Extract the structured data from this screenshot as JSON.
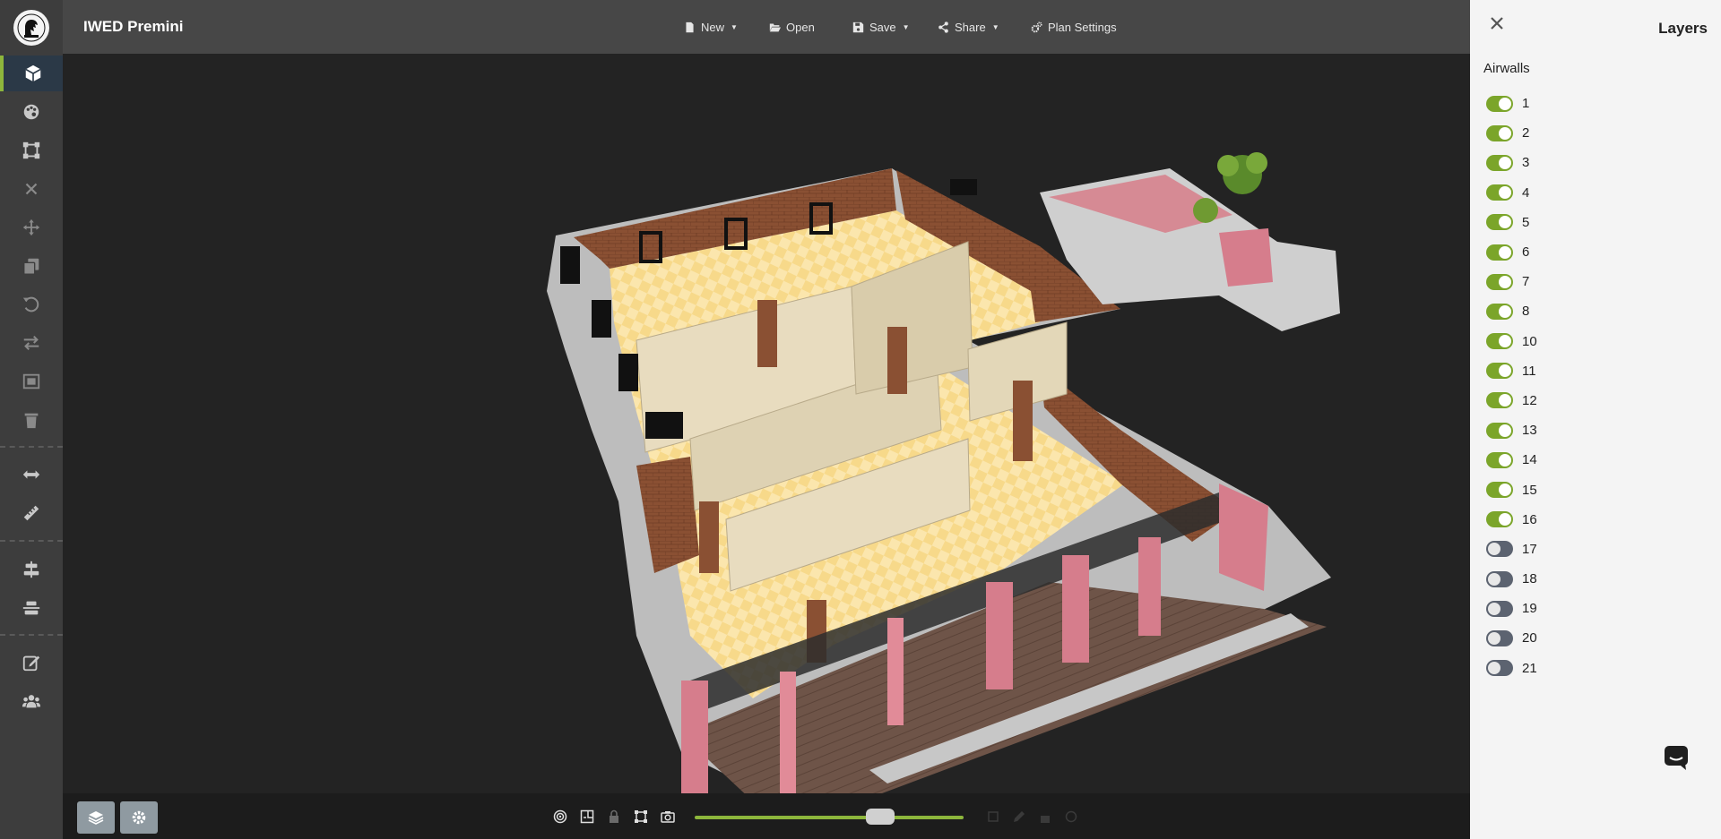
{
  "app": {
    "title": "IWED Premini"
  },
  "toolbar": {
    "menus": [
      {
        "label": "New",
        "icon": "file-icon",
        "dropdown": true
      },
      {
        "label": "Open",
        "icon": "folder-open-icon",
        "dropdown": false
      },
      {
        "label": "Save",
        "icon": "save-icon",
        "dropdown": true
      },
      {
        "label": "Share",
        "icon": "share-icon",
        "dropdown": true
      },
      {
        "label": "Plan Settings",
        "icon": "cogs-icon",
        "dropdown": false
      }
    ]
  },
  "sidebar": {
    "tools": [
      {
        "name": "3d-view",
        "icon": "cube-icon",
        "active": true
      },
      {
        "name": "decorate",
        "icon": "palette-icon"
      },
      {
        "name": "select-area",
        "icon": "vector-square-icon"
      },
      {
        "name": "cancel",
        "icon": "close-icon"
      },
      {
        "name": "move",
        "icon": "move-arrows-icon"
      },
      {
        "name": "copy",
        "icon": "copy-icon"
      },
      {
        "name": "rotate",
        "icon": "undo-icon"
      },
      {
        "name": "flip",
        "icon": "exchange-icon"
      },
      {
        "name": "image",
        "icon": "image-frame-icon"
      },
      {
        "name": "delete",
        "icon": "trash-icon"
      },
      {
        "name": "measure-width",
        "icon": "horizontal-arrows-icon"
      },
      {
        "name": "ruler",
        "icon": "ruler-icon"
      },
      {
        "name": "align-center",
        "icon": "align-center-icon"
      },
      {
        "name": "distribute",
        "icon": "distribute-icon"
      },
      {
        "name": "edit",
        "icon": "edit-icon"
      },
      {
        "name": "users",
        "icon": "users-icon"
      }
    ]
  },
  "layers_panel": {
    "title": "Layers",
    "section": "Airwalls",
    "items": [
      {
        "label": "1",
        "on": true
      },
      {
        "label": "2",
        "on": true
      },
      {
        "label": "3",
        "on": true
      },
      {
        "label": "4",
        "on": true
      },
      {
        "label": "5",
        "on": true
      },
      {
        "label": "6",
        "on": true
      },
      {
        "label": "7",
        "on": true
      },
      {
        "label": "8",
        "on": true
      },
      {
        "label": "10",
        "on": true
      },
      {
        "label": "11",
        "on": true
      },
      {
        "label": "12",
        "on": true
      },
      {
        "label": "13",
        "on": true
      },
      {
        "label": "14",
        "on": true
      },
      {
        "label": "15",
        "on": true
      },
      {
        "label": "16",
        "on": true
      },
      {
        "label": "17",
        "on": false
      },
      {
        "label": "18",
        "on": false
      },
      {
        "label": "19",
        "on": false
      },
      {
        "label": "20",
        "on": false
      },
      {
        "label": "21",
        "on": false
      }
    ]
  },
  "bottom_bar": {
    "zoom_slider": 0.69
  },
  "colors": {
    "accent": "#8db63c",
    "toggle_on": "#7ba52a",
    "toggle_off": "#5c6370",
    "rail_bg": "#3d3d3d",
    "topbar_bg": "#474747",
    "panel_bg": "#f4f4f4"
  }
}
